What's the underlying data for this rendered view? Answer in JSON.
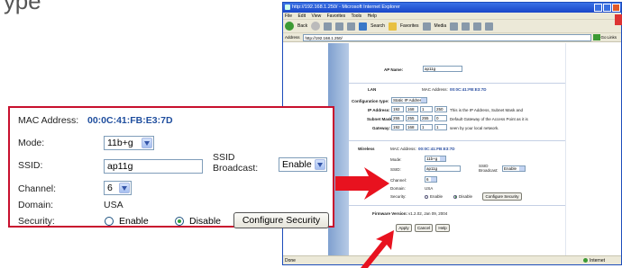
{
  "page_header": "уре",
  "ie": {
    "title": "http://192.168.1.250/ - Microsoft Internet Explorer",
    "menu": [
      "File",
      "Edit",
      "View",
      "Favorites",
      "Tools",
      "Help"
    ],
    "toolbar": {
      "back": "Back",
      "search": "Search",
      "favorites": "Favorites",
      "media": "Media"
    },
    "address": {
      "label": "Address",
      "value": "http://192.168.1.250/",
      "go": "Go",
      "links": "Links"
    },
    "page": {
      "ap_name_label": "AP Name:",
      "ap_name_value": "ap11g",
      "lan": {
        "section": "LAN",
        "mac_label": "MAC Address:",
        "mac_value": "00:0C:41:FB:E3:7D",
        "config_type_label": "Configuration type:",
        "config_type_value": "Static IP Address",
        "ip_label": "IP Address:",
        "ip": [
          "192",
          "168",
          "1",
          "250"
        ],
        "ip_note": "This is the IP Address, Subnet Mask and",
        "subnet_label": "Subnet Mask:",
        "subnet": [
          "255",
          "255",
          "255",
          "0"
        ],
        "subnet_note": "Default Gateway of the Access Point as it is",
        "gateway_label": "Gateway:",
        "gateway": [
          "192",
          "168",
          "1",
          "1"
        ],
        "gateway_note": "seen by your local network."
      },
      "wireless": {
        "section": "Wireless",
        "mac_label": "MAC Address:",
        "mac_value": "00:0C:41:FB:E3:7D",
        "mode_label": "Mode:",
        "mode_value": "11b+g",
        "ssid_label": "SSID:",
        "ssid_value": "ap11g",
        "ssid_broadcast_label": "SSID Broadcast:",
        "ssid_broadcast_value": "Enable",
        "channel_label": "Channel:",
        "channel_value": "6",
        "domain_label": "Domain:",
        "domain_value": "USA",
        "security_label": "Security:",
        "enable_label": "Enable",
        "disable_label": "Disable",
        "configure_security": "Configure Security"
      },
      "firmware_label": "Firmware Version:",
      "firmware_value": "v1.2.02, Jan 09, 2004",
      "apply": "Apply",
      "cancel": "Cancel",
      "help": "Help"
    },
    "status": {
      "left": "Done",
      "zone": "Internet"
    }
  },
  "zoom": {
    "mac_label": "MAC Address:",
    "mac_value": "00:0C:41:FB:E3:7D",
    "mode_label": "Mode:",
    "mode_value": "11b+g",
    "ssid_label": "SSID:",
    "ssid_value": "ap11g",
    "ssid_broadcast_line1": "SSID",
    "ssid_broadcast_line2": "Broadcast:",
    "ssid_broadcast_value": "Enable",
    "channel_label": "Channel:",
    "channel_value": "6",
    "domain_label": "Domain:",
    "domain_value": "USA",
    "security_label": "Security:",
    "enable_label": "Enable",
    "disable_label": "Disable",
    "configure_security": "Configure Security"
  },
  "colors": {
    "callout_red": "#c8102e",
    "mac_blue": "#1f4e9e",
    "arrow_red": "#e8121f"
  }
}
